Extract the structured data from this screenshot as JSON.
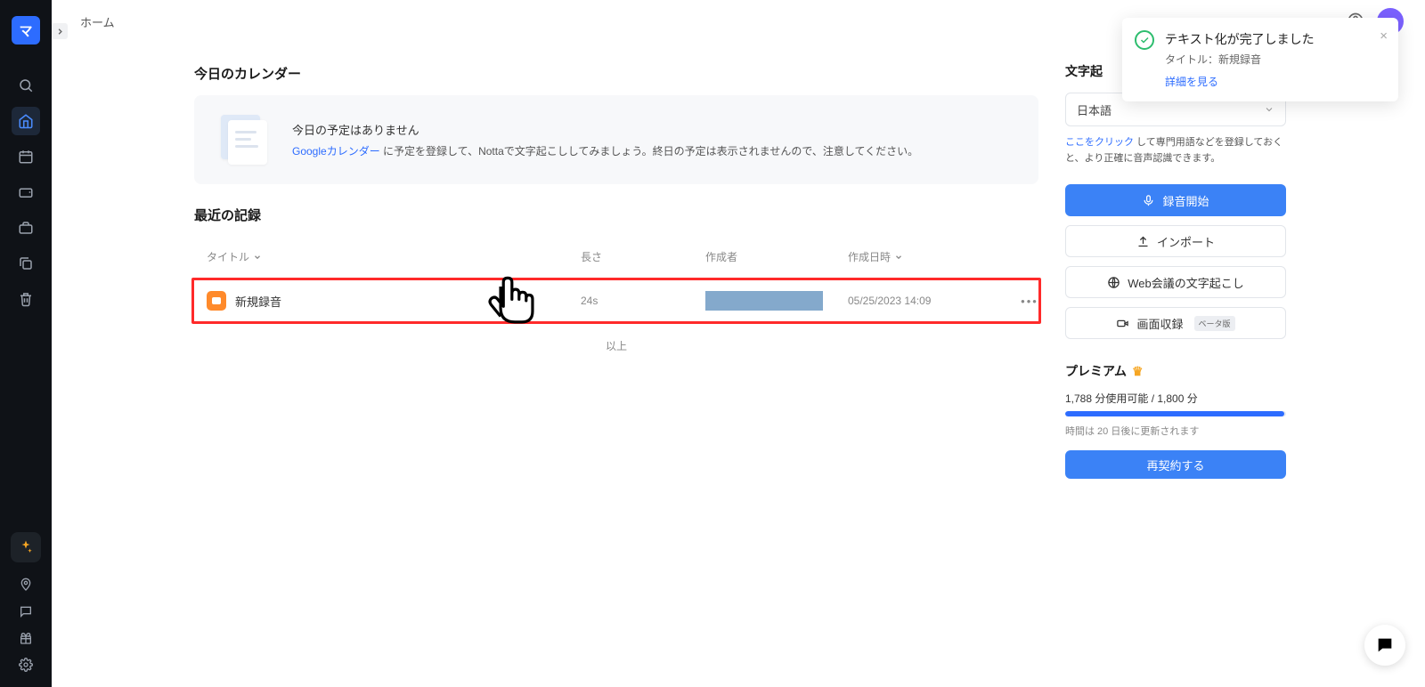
{
  "app": {
    "logo_glyph": "マ",
    "breadcrumb": "ホーム"
  },
  "sidebar_icons": [
    "search",
    "home",
    "calendar",
    "wallet",
    "briefcase",
    "copy",
    "trash"
  ],
  "calendar": {
    "section_title": "今日のカレンダー",
    "no_schedule": "今日の予定はありません",
    "hint_link": "Googleカレンダー",
    "hint_rest": " に予定を登録して、Nottaで文字起こししてみましょう。終日の予定は表示されませんので、注意してください。"
  },
  "records": {
    "section_title": "最近の記録",
    "columns": {
      "title": "タイトル",
      "length": "長さ",
      "creator": "作成者",
      "created_at": "作成日時"
    },
    "rows": [
      {
        "title": "新規録音",
        "length": "24s",
        "creator": "",
        "created_at": "05/25/2023 14:09"
      }
    ],
    "footer": "以上"
  },
  "right": {
    "heading": "文字起",
    "language": "日本語",
    "hint_link": "ここをクリック",
    "hint_rest": " して専門用語などを登録しておくと、より正確に音声認識できます。",
    "btn_record": "録音開始",
    "btn_import": "インポート",
    "btn_meeting": "Web会議の文字起こし",
    "btn_screen": "画面収録",
    "btn_screen_badge": "ベータ版"
  },
  "premium": {
    "title": "プレミアム",
    "usage": "1,788 分使用可能 / 1,800 分",
    "reset": "時間は 20 日後に更新されます",
    "renew": "再契約する"
  },
  "toast": {
    "title": "テキスト化が完了しました",
    "subtitle": "タイトル：新規録音",
    "link": "詳細を見る"
  }
}
